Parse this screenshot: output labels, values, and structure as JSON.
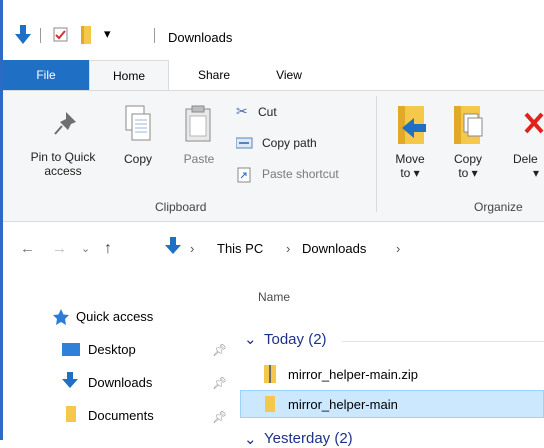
{
  "window": {
    "title": "Downloads"
  },
  "ribbon": {
    "tabs": [
      {
        "label": "File"
      },
      {
        "label": "Home"
      },
      {
        "label": "Share"
      },
      {
        "label": "View"
      }
    ],
    "clipboard": {
      "pin_to_quick_access_line1": "Pin to Quick",
      "pin_to_quick_access_line2": "access",
      "copy": "Copy",
      "paste": "Paste",
      "cut": "Cut",
      "copy_path": "Copy path",
      "paste_shortcut": "Paste shortcut",
      "group_label": "Clipboard"
    },
    "organize": {
      "move_to_line1": "Move",
      "move_to_line2": "to",
      "copy_to_line1": "Copy",
      "copy_to_line2": "to",
      "delete_partial": "Dele",
      "group_label": "Organize"
    }
  },
  "address": {
    "crumbs": [
      "This PC",
      "Downloads"
    ]
  },
  "nav_pane": {
    "quick_access": "Quick access",
    "items": [
      {
        "label": "Desktop"
      },
      {
        "label": "Downloads"
      },
      {
        "label": "Documents"
      }
    ]
  },
  "file_list": {
    "column_name": "Name",
    "group_today": "Today (2)",
    "files": [
      {
        "name": "mirror_helper-main.zip"
      },
      {
        "name": "mirror_helper-main"
      }
    ],
    "group_yesterday": "Yesterday (2)"
  },
  "colors": {
    "accent": "#1f6fc5",
    "selection": "#cce8ff",
    "folder": "#f3c84b"
  }
}
